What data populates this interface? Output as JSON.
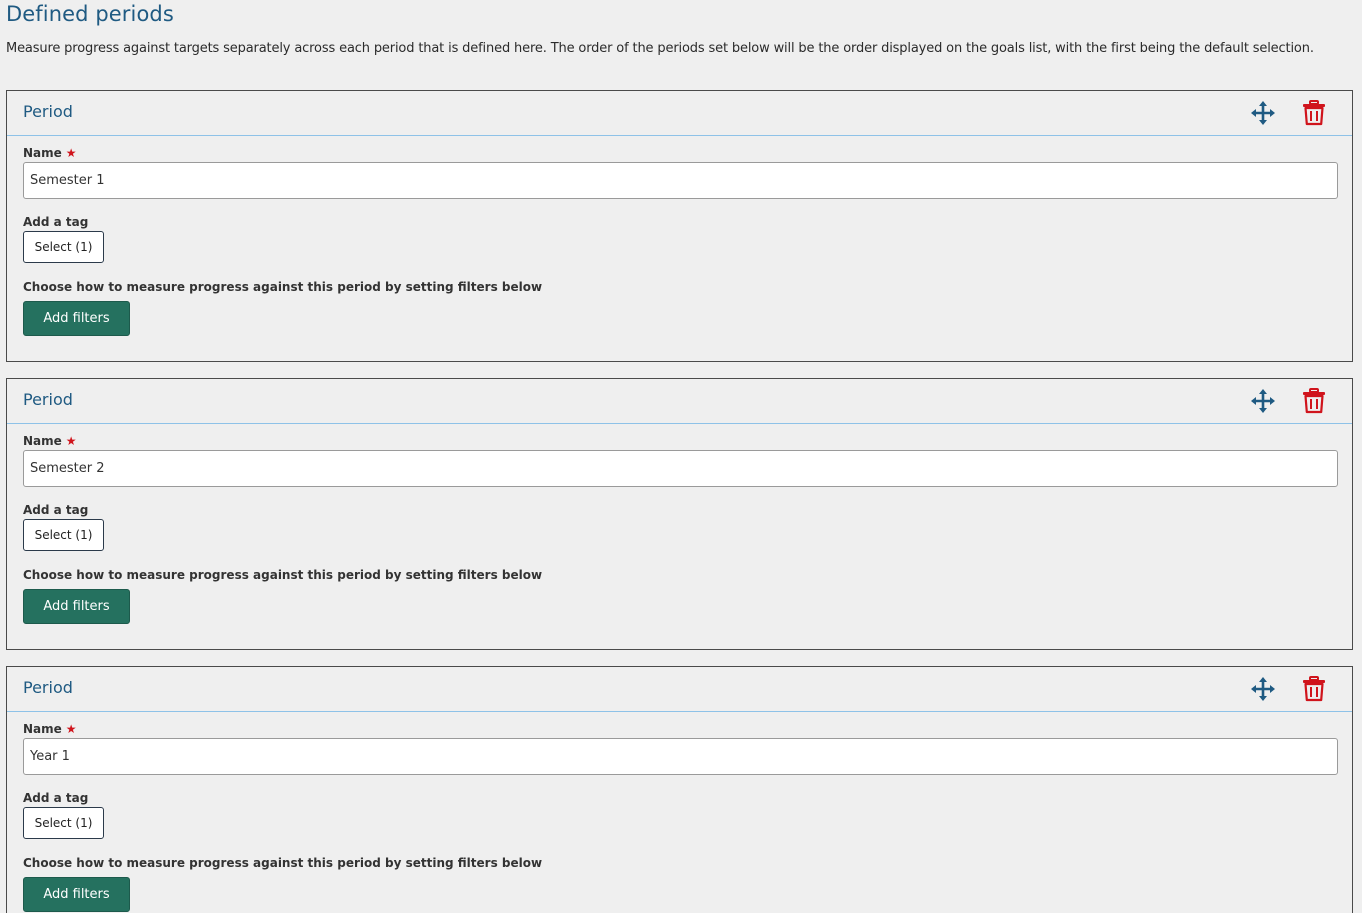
{
  "page": {
    "title": "Defined periods",
    "description": "Measure progress against targets separately across each period that is defined here. The order of the periods set below will be the order displayed on the goals list, with the first being the default selection."
  },
  "periods": [
    {
      "header": "Period",
      "name_label": "Name",
      "name_value": "Semester 1",
      "tag_label": "Add a tag",
      "tag_button": "Select (1)",
      "filters_label": "Choose how to measure progress against this period by setting filters below",
      "filters_button": "Add filters"
    },
    {
      "header": "Period",
      "name_label": "Name",
      "name_value": "Semester 2",
      "tag_label": "Add a tag",
      "tag_button": "Select (1)",
      "filters_label": "Choose how to measure progress against this period by setting filters below",
      "filters_button": "Add filters"
    },
    {
      "header": "Period",
      "name_label": "Name",
      "name_value": "Year 1",
      "tag_label": "Add a tag",
      "tag_button": "Select (1)",
      "filters_label": "Choose how to measure progress against this period by setting filters below",
      "filters_button": "Add filters"
    }
  ],
  "icons": {
    "move": "move-arrows-icon",
    "delete": "trash-icon",
    "required": "required-star-icon"
  },
  "colors": {
    "accent": "#1f5a82",
    "header_rule": "#8ec2e8",
    "primary_button": "#25715f",
    "danger": "#d0141c",
    "background": "#efefef"
  }
}
